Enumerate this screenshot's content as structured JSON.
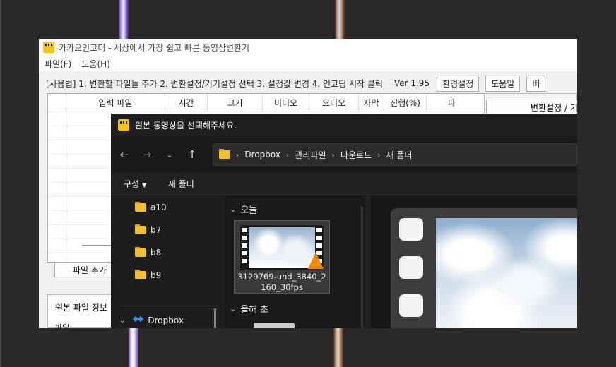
{
  "app": {
    "title": "카카오인코더 - 세상에서 가장 쉽고 빠른 동영상변환기",
    "menu": [
      "파일(F)",
      "도움(H)"
    ],
    "usage_text": "[사용법] 1. 변환할 파일들 추가   2. 변환설정/기기설정 선택   3. 설정값 변경   4. 인코딩 시작 클릭",
    "version": "Ver 1.95",
    "buttons": {
      "settings": "환경설정",
      "help": "도움말",
      "more": "버"
    },
    "table_headers": [
      "입력 파일",
      "시간",
      "크기",
      "비디오",
      "오디오",
      "자막",
      "진행(%)",
      "파"
    ],
    "add_file_button": "파일 추가",
    "info_panel_label": "원본 파일 정보",
    "info_panel_sub": "파일",
    "right_tab_label": "변환설정 / 기"
  },
  "dialog": {
    "title": "원본 동영상을 선택해주세요.",
    "breadcrumb": [
      "Dropbox",
      "관리파일",
      "다운로드",
      "새 폴더"
    ],
    "commands": {
      "organize": "구성",
      "new_folder": "새 폴더"
    },
    "nav_folders": [
      "a10",
      "b7",
      "b8",
      "b9"
    ],
    "nav_dropbox": "Dropbox",
    "groups": {
      "today": "오늘",
      "early_year": "올해 초"
    },
    "file": {
      "name_line1": "3129769-uhd_3840_2",
      "name_line2": "160_30fps"
    }
  },
  "colors": {
    "folder": "#f0c033",
    "dialog_bg": "#202020",
    "app_bg": "#f0f0f0",
    "vlc_orange": "#f08c00"
  }
}
